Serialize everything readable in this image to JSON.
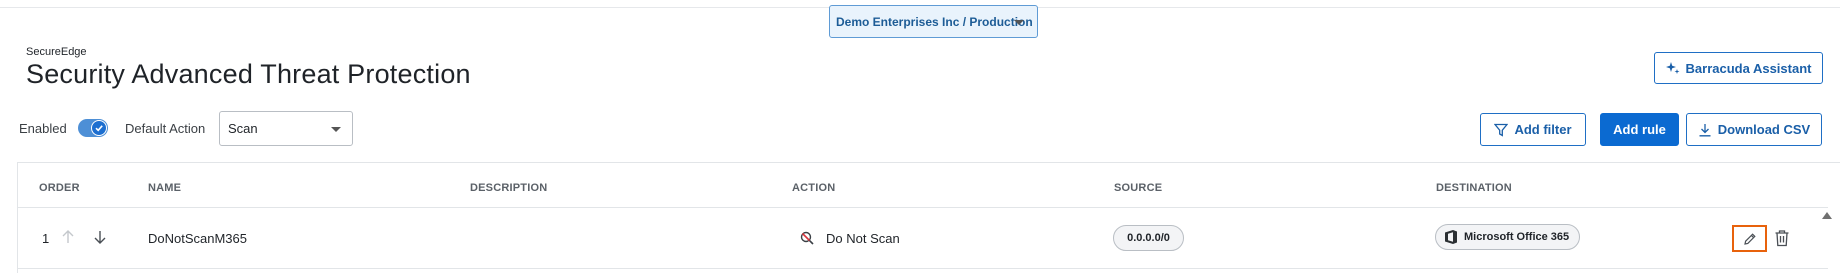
{
  "env_selector": {
    "label": "Demo Enterprises Inc / Production"
  },
  "header": {
    "app_name": "SecureEdge",
    "title": "Security Advanced Threat Protection",
    "assistant_label": "Barracuda Assistant"
  },
  "toolbar": {
    "enabled_label": "Enabled",
    "enabled": true,
    "default_action_label": "Default Action",
    "default_action_value": "Scan",
    "add_filter_label": "Add filter",
    "add_rule_label": "Add rule",
    "download_label": "Download CSV"
  },
  "table": {
    "columns": [
      "ORDER",
      "NAME",
      "DESCRIPTION",
      "ACTION",
      "SOURCE",
      "DESTINATION"
    ],
    "rows": [
      {
        "order": "1",
        "name": "DoNotScanM365",
        "description": "",
        "action": "Do Not Scan",
        "source": "0.0.0.0/0",
        "destination": "Microsoft Office 365"
      }
    ]
  },
  "colors": {
    "accent": "#0b6ad1",
    "highlight": "#e8620c"
  },
  "icons": [
    "chevron-down-icon",
    "sparkle-icon",
    "filter-icon",
    "download-icon",
    "arrow-up-icon",
    "arrow-down-icon",
    "no-scan-icon",
    "office365-icon",
    "edit-icon",
    "trash-icon",
    "check-icon"
  ]
}
